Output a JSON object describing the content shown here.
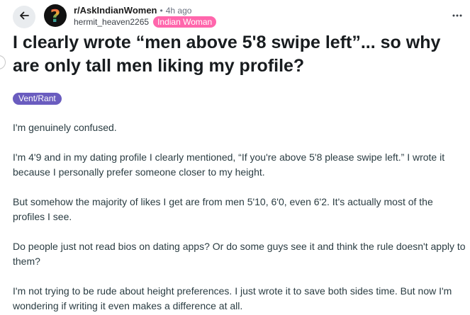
{
  "post": {
    "subreddit": "r/AskIndianWomen",
    "separator": "•",
    "time_ago": "4h ago",
    "username": "hermit_heaven2265",
    "user_flair": "Indian Woman",
    "title": "I clearly wrote “men above 5'8 swipe left”... so why are only tall men liking my profile?",
    "post_flair": "Vent/Rant",
    "paragraphs": [
      "I'm genuinely confused.",
      "I'm 4'9 and in my dating profile I clearly mentioned, “If you're above 5'8 please swipe left.” I wrote it because I personally prefer someone closer to my height.",
      "But somehow the majority of likes I get are from men 5'10, 6'0, even 6'2. It's actually most of the profiles I see.",
      "Do people just not read bios on dating apps? Or do some guys see it and think the rule doesn't apply to them?",
      "I'm not trying to be rude about height preferences. I just wrote it to save both sides time. But now I'm wondering if writing it even makes a difference at all."
    ]
  },
  "icons": {
    "back": "arrow-left-icon",
    "avatar": "question-mark-avatar-icon",
    "more": "more-horizontal-icon"
  },
  "colors": {
    "user_flair_bg": "#ff66ac",
    "post_flair_bg": "#6a5cbf",
    "back_button_bg": "#e9ecef"
  }
}
